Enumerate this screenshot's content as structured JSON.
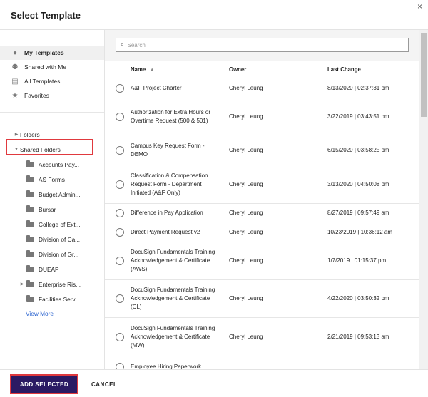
{
  "title": "Select Template",
  "nav": [
    {
      "label": "My Templates",
      "icon": "person-icon"
    },
    {
      "label": "Shared with Me",
      "icon": "people-icon"
    },
    {
      "label": "All Templates",
      "icon": "template-icon"
    },
    {
      "label": "Favorites",
      "icon": "star-icon"
    }
  ],
  "tree": {
    "folders": "Folders",
    "shared": "Shared Folders",
    "items": [
      "Accounts Pay...",
      "AS Forms",
      "Budget Admin...",
      "Bursar",
      "College of Ext...",
      "Division of Ca...",
      "Division of Gr...",
      "DUEAP",
      "Enterprise Ris...",
      "Facilities Servi..."
    ],
    "view_more": "View More"
  },
  "search": {
    "placeholder": "Search"
  },
  "columns": {
    "name": "Name",
    "sort": "▲",
    "owner": "Owner",
    "last": "Last Change"
  },
  "rows": [
    {
      "name": "A&F Project Charter",
      "owner": "Cheryl Leung",
      "date": "8/13/2020 | 02:37:31 pm"
    },
    {
      "name": "Authorization for Extra Hours or Overtime Request (500 & 501)",
      "owner": "Cheryl Leung",
      "date": "3/22/2019 | 03:43:51 pm"
    },
    {
      "name": "Campus Key Request Form - DEMO",
      "owner": "Cheryl Leung",
      "date": "6/15/2020 | 03:58:25 pm"
    },
    {
      "name": "Classification & Compensation Request Form - Department Initiated (A&F Only)",
      "owner": "Cheryl Leung",
      "date": "3/13/2020 | 04:50:08 pm"
    },
    {
      "name": "Difference in Pay Application",
      "owner": "Cheryl Leung",
      "date": "8/27/2019 | 09:57:49 am"
    },
    {
      "name": "Direct Payment Request v2",
      "owner": "Cheryl Leung",
      "date": "10/23/2019 | 10:36:12 am"
    },
    {
      "name": "DocuSign Fundamentals Training Acknowledgement & Certificate (AWS)",
      "owner": "Cheryl Leung",
      "date": "1/7/2019 | 01:15:37 pm"
    },
    {
      "name": "DocuSign Fundamentals Training Acknowledgement & Certificate (CL)",
      "owner": "Cheryl Leung",
      "date": "4/22/2020 | 03:50:32 pm"
    },
    {
      "name": "DocuSign Fundamentals Training Acknowledgement & Certificate (MW)",
      "owner": "Cheryl Leung",
      "date": "2/21/2019 | 09:53:13 am"
    },
    {
      "name": "Employee Hiring Paperwork",
      "owner": "",
      "date": ""
    }
  ],
  "footer": {
    "add": "ADD SELECTED",
    "cancel": "CANCEL"
  }
}
